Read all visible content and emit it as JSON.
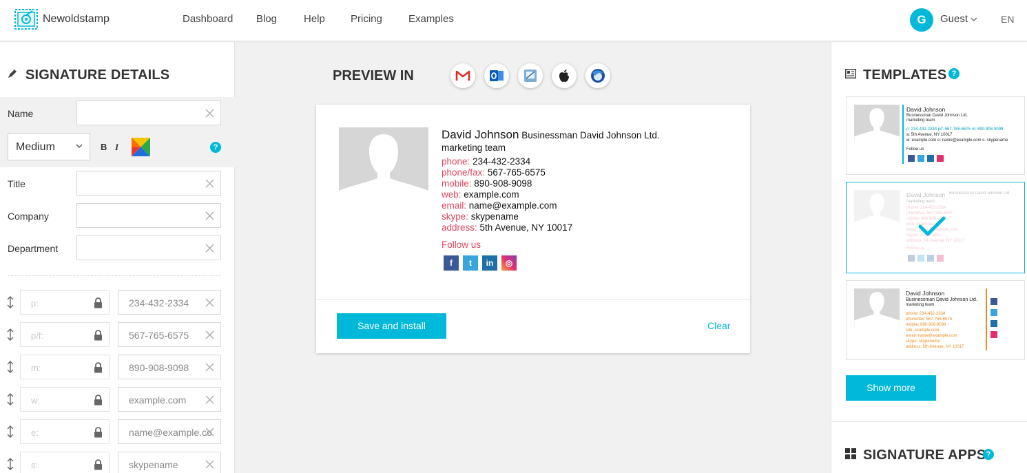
{
  "app": {
    "name": "Newoldstamp"
  },
  "nav": {
    "items": [
      "Dashboard",
      "Blog",
      "Help",
      "Pricing",
      "Examples"
    ]
  },
  "user": {
    "initial": "G",
    "name": "Guest",
    "lang": "EN"
  },
  "details": {
    "title": "SIGNATURE DETAILS",
    "name_label": "Name",
    "font_size": "Medium",
    "bold": "B",
    "italic": "I",
    "title_label": "Title",
    "company_label": "Company",
    "department_label": "Department",
    "help": "?",
    "contacts": [
      {
        "label": "p:",
        "value": "234-432-2334"
      },
      {
        "label": "p/f:",
        "value": "567-765-6575"
      },
      {
        "label": "m:",
        "value": "890-908-9098"
      },
      {
        "label": "w:",
        "value": "example.com"
      },
      {
        "label": "e:",
        "value": "name@example.com"
      },
      {
        "label": "s:",
        "value": "skypename"
      }
    ]
  },
  "preview": {
    "title": "PREVIEW IN",
    "clients": [
      "gmail-icon",
      "outlook-icon",
      "apple-mail-icon",
      "apple-icon",
      "thunderbird-icon"
    ],
    "signature": {
      "name": "David Johnson",
      "company": "Businessman David Johnson Ltd.",
      "department": "marketing team",
      "phone_label": "phone:",
      "phone": "234-432-2334",
      "fax_label": "phone/fax:",
      "fax": "567-765-6575",
      "mobile_label": "mobile:",
      "mobile": "890-908-9098",
      "web_label": "web:",
      "web": "example.com",
      "email_label": "email:",
      "email": "name@example.com",
      "skype_label": "skype:",
      "skype": "skypename",
      "address_label": "address:",
      "address": "5th Avenue, NY 10017",
      "follow": "Follow us",
      "social": [
        {
          "icon": "facebook-icon",
          "glyph": "f",
          "color": "#3b5998"
        },
        {
          "icon": "twitter-icon",
          "glyph": "t",
          "color": "#3aa5dd"
        },
        {
          "icon": "linkedin-icon",
          "glyph": "in",
          "color": "#1f6fa8"
        },
        {
          "icon": "instagram-icon",
          "glyph": "◎",
          "color": "#e1306c"
        }
      ]
    },
    "save_label": "Save and install",
    "clear_label": "Clear"
  },
  "templates": {
    "title": "TEMPLATES",
    "help": "?",
    "show_more": "Show more",
    "apps_title": "SIGNATURE APPS",
    "apps_help": "?",
    "t1": {
      "name": "David Johnson",
      "company": "Businessman David Johnson Ltd.",
      "dept": "marketing team",
      "line1": "p: 234-432-2334  p/f: 567-765-6575  m: 890-908-9098",
      "line2": "a: 5th Avenue, NY 10017",
      "line3": "w: example.com  e: name@example.com  s: skypename",
      "follow": "Follow us"
    },
    "t2": {
      "name": "David Johnson",
      "company": "Businessman David Johnson Ltd.",
      "dept": "marketing team",
      "lines": [
        "phone: 234-432-2334",
        "phone/fax: 567-765-6575",
        "mobile: 890-908-9098",
        "web: example.com",
        "email: name@example.com",
        "skype: skypename",
        "address: 5th Avenue, NY 10017"
      ],
      "follow": "Follow us"
    },
    "t3": {
      "name": "David Johnson",
      "company": "Businessman David Johnson Ltd.",
      "dept": "marketing team",
      "lines": [
        "phone: 234-432-2334",
        "phone/fax: 567-765-6575",
        "mobile: 890-908-9098",
        "site: example.com",
        "email: name@example.com",
        "skype: skypename",
        "address: 5th Avenue, NY 10017"
      ]
    }
  },
  "colors": {
    "accent": "#00b8d9",
    "label_red": "#e04762",
    "label_orange": "#f08b1d"
  }
}
